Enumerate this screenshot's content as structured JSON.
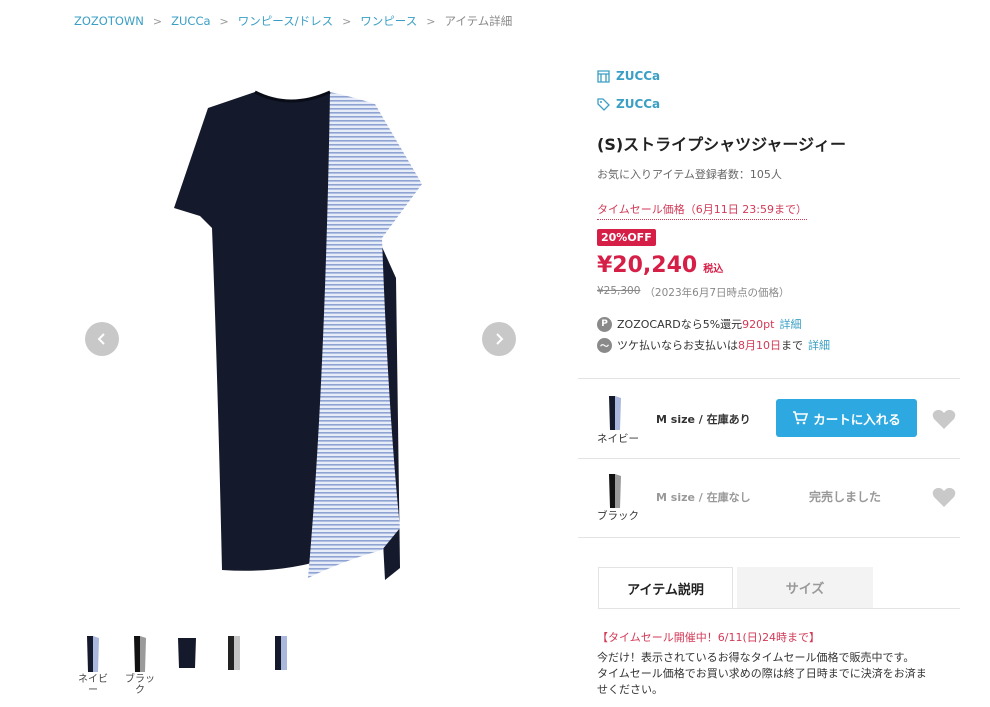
{
  "breadcrumb": [
    "ZOZOTOWN",
    "ZUCCa",
    "ワンピース/ドレス",
    "ワンピース",
    "アイテム詳細"
  ],
  "brand": {
    "shop": "ZUCCa",
    "brand": "ZUCCa"
  },
  "product": {
    "title": "(S)ストライプシャツジャージィー",
    "favorites": "お気に入りアイテム登録者数：105人",
    "sale_label": "タイムセール価格（6月11日 23:59まで）",
    "discount": "20%OFF",
    "price": "¥20,240",
    "tax": "税込",
    "orig_price": "¥25,300",
    "orig_note": "（2023年6月7日時点の価格）"
  },
  "points": {
    "zozocard_prefix": "ZOZOCARDなら5%還元",
    "zozocard_pt": "920pt",
    "zozocard_link": "詳細",
    "tsuke_prefix": "ツケ払いならお支払いは",
    "tsuke_date": "8月10日",
    "tsuke_suffix": "まで",
    "tsuke_link": "詳細"
  },
  "variants": [
    {
      "color": "ネイビー",
      "size_stock": "M size / 在庫あり",
      "action": "カートに入れる"
    },
    {
      "color": "ブラック",
      "size_stock": "M size / 在庫なし",
      "action": "完売しました"
    }
  ],
  "tabs": [
    "アイテム説明",
    "サイズ"
  ],
  "description": {
    "headline": "【タイムセール開催中！6/11(日)24時まで】",
    "line1": "今だけ！表示されているお得なタイムセール価格で販売中です。",
    "line2": "タイムセール価格でお買い求めの際は終了日時までに決済をお済ま",
    "line3": "せください。"
  },
  "thumbnails": [
    {
      "label": "ネイビー"
    },
    {
      "label": "ブラック"
    },
    {
      "label": ""
    },
    {
      "label": ""
    },
    {
      "label": ""
    }
  ],
  "colors": {
    "accent": "#3a9fc4",
    "sale": "#d61f47",
    "cart": "#2da8e0",
    "navy": "#141a2c",
    "stripe": "#a9b8dc"
  }
}
